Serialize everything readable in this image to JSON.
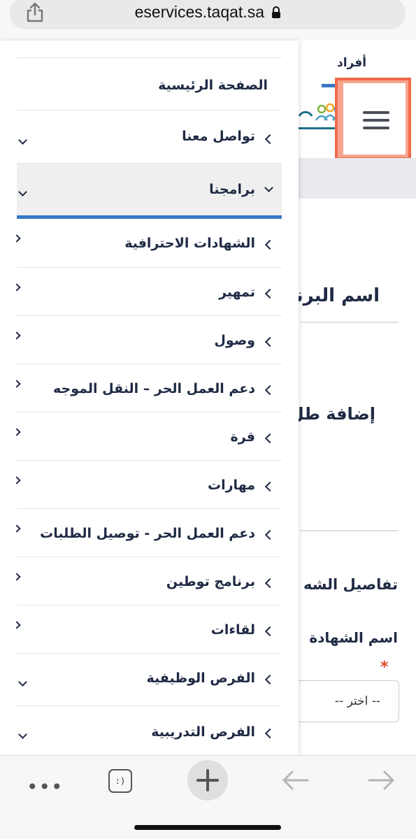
{
  "browser": {
    "url": "eservices.taqat.sa",
    "icons": {
      "share": "share-icon",
      "lock": "lock-icon"
    }
  },
  "background_page": {
    "tab_label": "أفراد",
    "heading_program": "اسم البرنا",
    "heading_add": "إضافة طل",
    "heading_details": "تفاصيل الشه",
    "field_label": "اسم الشهادة",
    "required_mark": "*",
    "select_value": "-- اختر --",
    "accent_color": "#3a78c9",
    "highlight_color": "#ef6a4a"
  },
  "drawer": {
    "items": [
      {
        "label": "الصفحة الرئيسية",
        "chevron": "none"
      },
      {
        "label": "تواصل معنا",
        "chevron": "down"
      },
      {
        "label": "برامجنا",
        "chevron": "expanded",
        "active": true
      },
      {
        "label": "الشهادات الاحترافية",
        "chevron": "sub"
      },
      {
        "label": "تمهير",
        "chevron": "sub"
      },
      {
        "label": "وصول",
        "chevron": "sub"
      },
      {
        "label": "دعم العمل الحر – النقل الموجه",
        "chevron": "sub"
      },
      {
        "label": "قرة",
        "chevron": "sub"
      },
      {
        "label": "مهارات",
        "chevron": "sub"
      },
      {
        "label": "دعم العمل الحر - توصيل الطلبات",
        "chevron": "sub"
      },
      {
        "label": "برنامج توطين",
        "chevron": "sub"
      },
      {
        "label": "لقاءات",
        "chevron": "sub"
      },
      {
        "label": "الفرص الوظيفية",
        "chevron": "down"
      },
      {
        "label": "الفرص التدريبية",
        "chevron": "down"
      }
    ]
  },
  "toolbar": {
    "tabs_label": ":)",
    "icons": [
      "more-dots-icon",
      "tabs-icon",
      "new-tab-plus-icon",
      "back-arrow-icon",
      "forward-arrow-icon"
    ]
  }
}
